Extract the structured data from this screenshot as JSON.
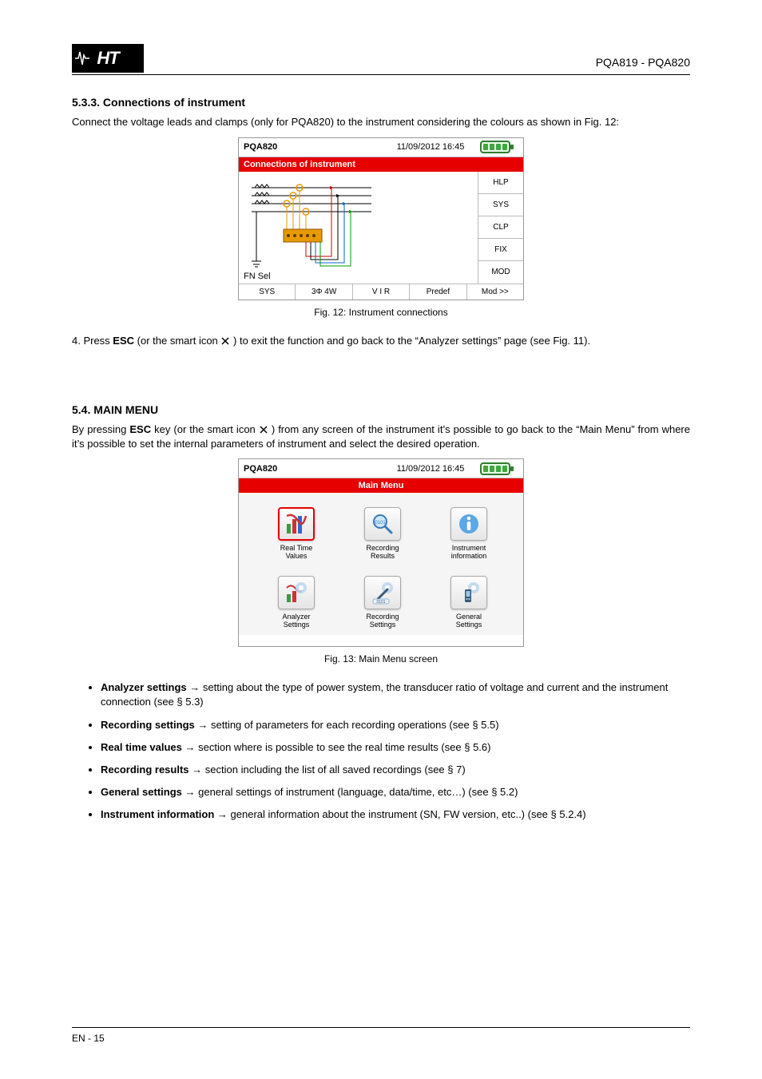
{
  "header": {
    "logo_text": "HT",
    "model": "PQA819 - PQA820"
  },
  "section1": {
    "title": "5.3.3. Connections of instrument",
    "para1": "Connect the voltage leads and clamps (only for PQA820) to the instrument considering the colours as shown in Fig. 12:",
    "caption": "Fig. 12: Instrument connections"
  },
  "deviceA": {
    "title": "PQA820",
    "time": "11/09/2012 16:45",
    "redbar": "Connections of instrument",
    "fn_sel": "FN Sel",
    "right_cells": [
      "HLP",
      "SYS",
      "CLP",
      "FIX",
      "MOD"
    ],
    "footer": [
      "SYS",
      "3Φ 4W",
      "V I R",
      "Predef",
      "Mod >>"
    ]
  },
  "section2": {
    "para": "4. Press ESC (or the smart icon ) to exit the function and go back to the \"Analyzer settings\" page (see Fig. 11)."
  },
  "section3": {
    "title": "5.4. MAIN MENU",
    "para": "By pressing ESC key (or the smart icon ) from any screen of the instrument it's possible to go back to the \"Main Menu\" from where it's possible to set the internal parameters of instrument and select the desired operation.",
    "caption": "Fig. 13: Main Menu screen"
  },
  "deviceB": {
    "title": "PQA820",
    "time": "11/09/2012 16:45",
    "redbar": "Main Menu",
    "icons": [
      {
        "name": "real-time-values",
        "label": "Real Time Values"
      },
      {
        "name": "recording-results",
        "label": "Recording Results"
      },
      {
        "name": "instrument-information",
        "label": "Instrument information"
      },
      {
        "name": "analyzer-settings",
        "label": "Analyzer Settings"
      },
      {
        "name": "recording-settings",
        "label": "Recording Settings"
      },
      {
        "name": "general-settings",
        "label": "General Settings"
      }
    ]
  },
  "bullets": [
    {
      "b": "Analyzer settings",
      "rest": "→ setting about the type of power system, the transducer ratio of voltage and current and the instrument connection (see § 5.3)"
    },
    {
      "b": "Recording settings",
      "rest": "→ setting of parameters for each recording operations (see § 5.5)"
    },
    {
      "b": "Real time values",
      "rest": "→ section where is possible to see the real time results (see § 5.6)"
    },
    {
      "b": "Recording results",
      "rest": "→ section including the list of all saved recordings (see § 7)"
    },
    {
      "b": "General settings",
      "rest": "→ general settings of instrument (language, data/time, etc…) (see § 5.2)"
    },
    {
      "b": "Instrument information",
      "rest": "→ general information about the instrument (SN, FW version, etc..) (see § 5.2.4)"
    }
  ],
  "footer": {
    "left": "EN - 15",
    "right": ""
  }
}
